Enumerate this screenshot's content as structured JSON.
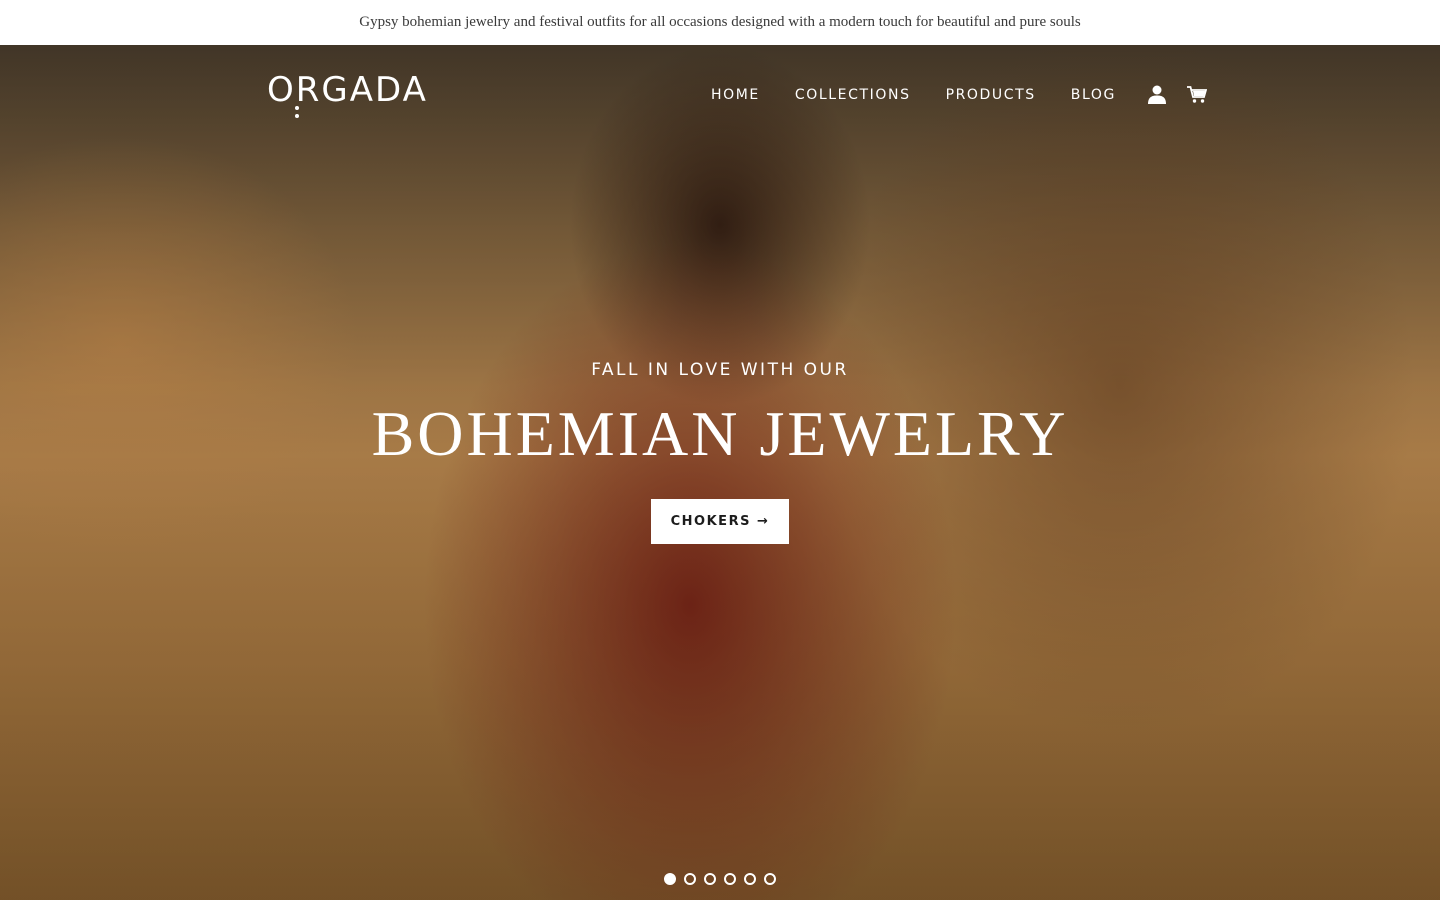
{
  "announcement": {
    "text": "Gypsy bohemian jewelry and festival outfits for all occasions designed with a modern touch for beautiful and pure souls"
  },
  "header": {
    "logo_text": "ORGADA",
    "nav": [
      "HOME",
      "COLLECTIONS",
      "PRODUCTS",
      "BLOG"
    ],
    "icons": {
      "account": "user-icon",
      "cart": "cart-icon"
    }
  },
  "hero": {
    "kicker": "FALL IN LOVE WITH OUR",
    "headline": "BOHEMIAN JEWELRY",
    "cta_label": "CHOKERS",
    "cta_arrow": "→",
    "slides_total": 6,
    "active_slide": 1
  },
  "colors": {
    "announcement_bg": "#ffffff",
    "text_on_hero": "#ffffff",
    "cta_bg": "#ffffff",
    "cta_text": "#1c1c1c"
  }
}
